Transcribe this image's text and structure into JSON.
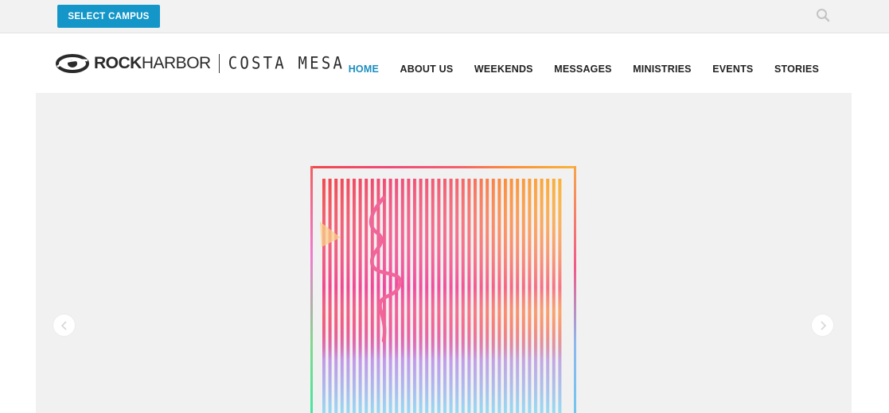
{
  "topbar": {
    "select_campus_label": "SELECT CAMPUS",
    "search_icon": "search-icon"
  },
  "brand": {
    "name_bold": "ROCK",
    "name_light": "HARBOR",
    "campus": "COSTA MESA",
    "logo_icon": "rockharbor-logo-icon"
  },
  "nav": {
    "items": [
      {
        "label": "HOME",
        "active": true
      },
      {
        "label": "ABOUT US",
        "active": false
      },
      {
        "label": "WEEKENDS",
        "active": false
      },
      {
        "label": "MESSAGES",
        "active": false
      },
      {
        "label": "MINISTRIES",
        "active": false
      },
      {
        "label": "EVENTS",
        "active": false
      },
      {
        "label": "STORIES",
        "active": false
      }
    ]
  },
  "hero": {
    "prev_icon": "chevron-left-icon",
    "next_icon": "chevron-right-icon"
  },
  "colors": {
    "accent": "#1496c8",
    "nav_active": "#1a8fbf",
    "topbar_bg": "#f2f2f2",
    "hero_bg": "#f1f1f1"
  }
}
